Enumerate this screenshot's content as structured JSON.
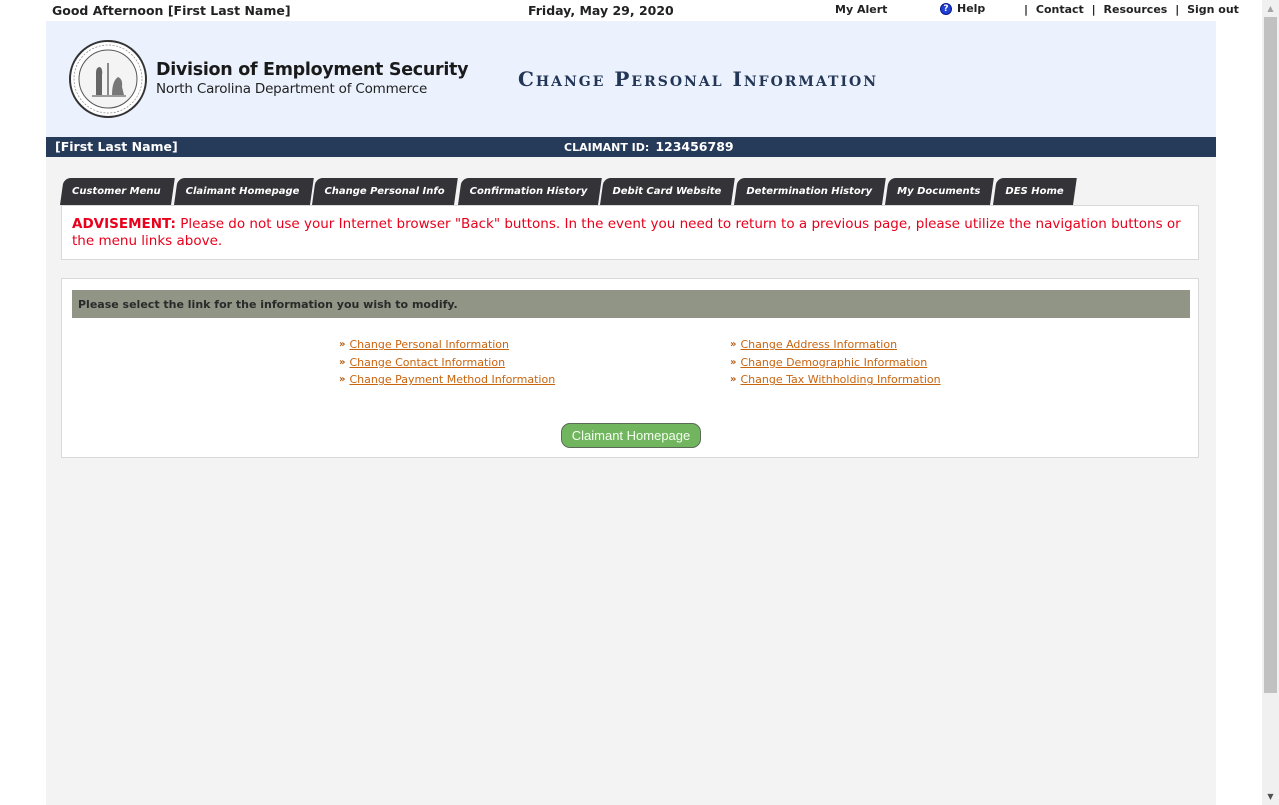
{
  "topbar": {
    "greeting": "Good Afternoon",
    "user_name": "[First Last Name]",
    "date": "Friday, May 29, 2020",
    "my_alert": "My Alert",
    "help_icon": "help-circle-icon",
    "help": "Help",
    "separator": "|",
    "contact": "Contact",
    "resources": "Resources",
    "sign_out": "Sign out"
  },
  "header": {
    "seal_icon": "nc-state-seal",
    "org_name": "Division of Employment Security",
    "org_sub": "North Carolina Department of Commerce",
    "page_title": "Change Personal Information"
  },
  "namebar": {
    "name": "[First Last Name]",
    "claimant_id_label": "CLAIMANT ID:",
    "claimant_id": "123456789"
  },
  "tabs": [
    {
      "label": "Customer Menu"
    },
    {
      "label": "Claimant Homepage"
    },
    {
      "label": "Change Personal Info"
    },
    {
      "label": "Confirmation History"
    },
    {
      "label": "Debit Card Website"
    },
    {
      "label": "Determination History"
    },
    {
      "label": "My Documents"
    },
    {
      "label": "DES Home"
    }
  ],
  "advisement": {
    "label": "ADVISEMENT:",
    "text": " Please do not use your Internet browser \"Back\" buttons. In the event you need to return to a previous page, please utilize the navigation buttons or the menu links above."
  },
  "content": {
    "instruction": "Please select the link for the information you wish to modify.",
    "arrow": "»",
    "links_left": [
      {
        "label": "Change Personal Information"
      },
      {
        "label": "Change Contact Information"
      },
      {
        "label": "Change Payment Method Information"
      }
    ],
    "links_right": [
      {
        "label": "Change Address Information"
      },
      {
        "label": "Change Demographic Information"
      },
      {
        "label": "Change Tax Withholding Information"
      }
    ],
    "home_button": "Claimant Homepage"
  },
  "colors": {
    "navy": "#263a5a",
    "header_bg": "#ebf2fe",
    "advisement_red": "#e8001c",
    "link_orange": "#c9640f",
    "button_green": "#72b55f",
    "instruction_bar": "#909585"
  }
}
